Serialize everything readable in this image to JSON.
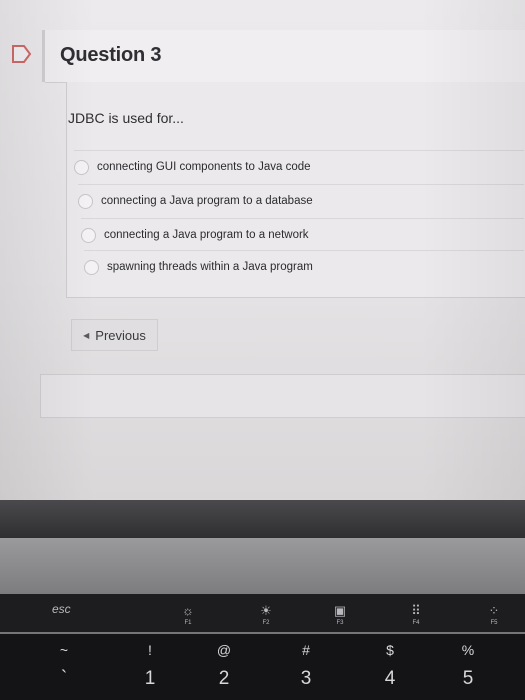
{
  "quiz": {
    "title": "Question 3",
    "question": "JDBC is used for...",
    "answers": [
      "connecting GUI components to Java code",
      "connecting a Java program to a database",
      "connecting a Java program to a network",
      "spawning threads within a Java program"
    ],
    "previous_label": "Previous"
  },
  "keyboard": {
    "esc": "esc",
    "fkeys": [
      "F1",
      "F2",
      "F3",
      "F4",
      "F5"
    ],
    "keys": [
      {
        "upper": "~",
        "lower": "`"
      },
      {
        "upper": "!",
        "lower": "1"
      },
      {
        "upper": "@",
        "lower": "2"
      },
      {
        "upper": "#",
        "lower": "3"
      },
      {
        "upper": "$",
        "lower": "4"
      },
      {
        "upper": "%",
        "lower": "5"
      }
    ]
  }
}
